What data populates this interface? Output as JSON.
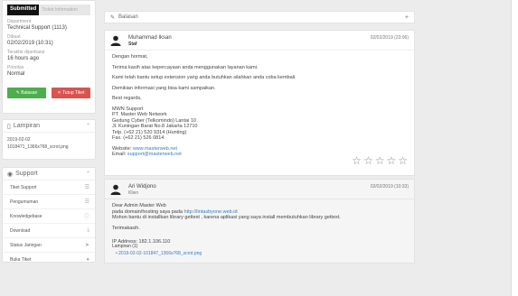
{
  "sidebar": {
    "tabs": {
      "active": "Submitted",
      "other": "Ticket Information"
    },
    "fields": [
      {
        "label": "Department",
        "value": "Technical Support (1113)"
      },
      {
        "label": "Dibuat",
        "value": "02/02/2019 (10:31)"
      },
      {
        "label": "Terakhir diperbarui",
        "value": "16 hours ago"
      },
      {
        "label": "Prioritas",
        "value": "Normal"
      }
    ],
    "reply_button": "Balasan",
    "close_button": "Tutup Tiket",
    "attachments": {
      "title": "Lampiran",
      "lines": [
        "2019-02-02",
        "1018471_1366x768_scrot.png"
      ]
    },
    "support": {
      "title": "Support",
      "items": [
        {
          "label": "Tiket Support",
          "icon": "list-icon"
        },
        {
          "label": "Pengumuman",
          "icon": "list-icon"
        },
        {
          "label": "Knowledgebase",
          "icon": "info-icon"
        },
        {
          "label": "Download",
          "icon": "download-icon"
        },
        {
          "label": "Status Jaringan",
          "icon": "send-icon"
        },
        {
          "label": "Buka Tiket",
          "icon": "chat-icon"
        }
      ]
    }
  },
  "main": {
    "reply_bar_label": "Balasan",
    "message1": {
      "name": "Muhammad Iksan",
      "role": "Staf",
      "date": "02/02/2019 (23:06)",
      "greeting": "Dengan hormat,",
      "p1": "Terima kasih atas kepercayaan anda menggunakan layanan kami.",
      "p2": "Kami telah bantu setup extension yang anda butuhkan silahkan anda coba kembali.",
      "p3": "Demikian informasi yang bisa kami sampaikan.",
      "regards": "Best regards,",
      "sig": [
        "MWN Support",
        "PT. Master Web Network",
        "Gedung Cyber (Telkomindo) Lantai 10",
        "Jl. Kuningan Barat No.8 Jakarta 12710",
        "Telp. (+62 21) 520 9314 (Hunting)",
        "Fax. (+62 21) 526 0814"
      ],
      "website_label": "Website: ",
      "website": "www.masterweb.net",
      "email_label": "Email: ",
      "email": "support@masterweb.net"
    },
    "message2": {
      "name": "Ari Widjono",
      "role": "Klien",
      "date": "02/02/2019 (10:33)",
      "greeting": "Dear Admin Master Web",
      "p1_prefix": "pada domain/hosting saya pada ",
      "p1_link": "http://lintasbyone.web.id",
      "p2": "Mohon bantu di installkan library gettext , karena aplikasi yang saya install membutuhkan library gettext.",
      "thanks": "Terimakasih.",
      "ip": "IP Address: 182.1.106.110",
      "attach_label": "Lampiran (1)",
      "attach_file": "• 2019-02-02-101847_1366x768_scrot.png"
    },
    "rating_stars": 5
  }
}
